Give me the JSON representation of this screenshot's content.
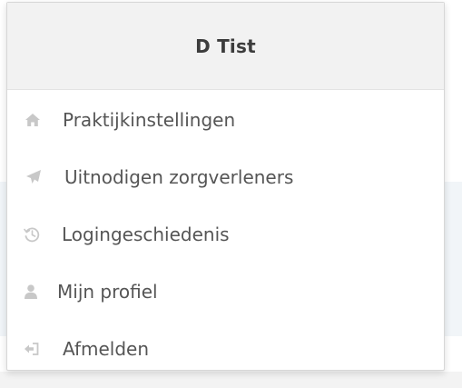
{
  "user": {
    "name": "D Tist"
  },
  "menu": {
    "items": [
      {
        "label": "Praktijkinstellingen",
        "icon": "home-icon"
      },
      {
        "label": "Uitnodigen zorgverleners",
        "icon": "paper-plane-icon"
      },
      {
        "label": "Logingeschiedenis",
        "icon": "history-icon"
      },
      {
        "label": "Mijn profiel",
        "icon": "user-icon"
      },
      {
        "label": "Afmelden",
        "icon": "sign-out-icon"
      }
    ]
  },
  "colors": {
    "header_bg": "#f2f2f2",
    "text": "#555555",
    "icon": "#c8c8c8"
  }
}
